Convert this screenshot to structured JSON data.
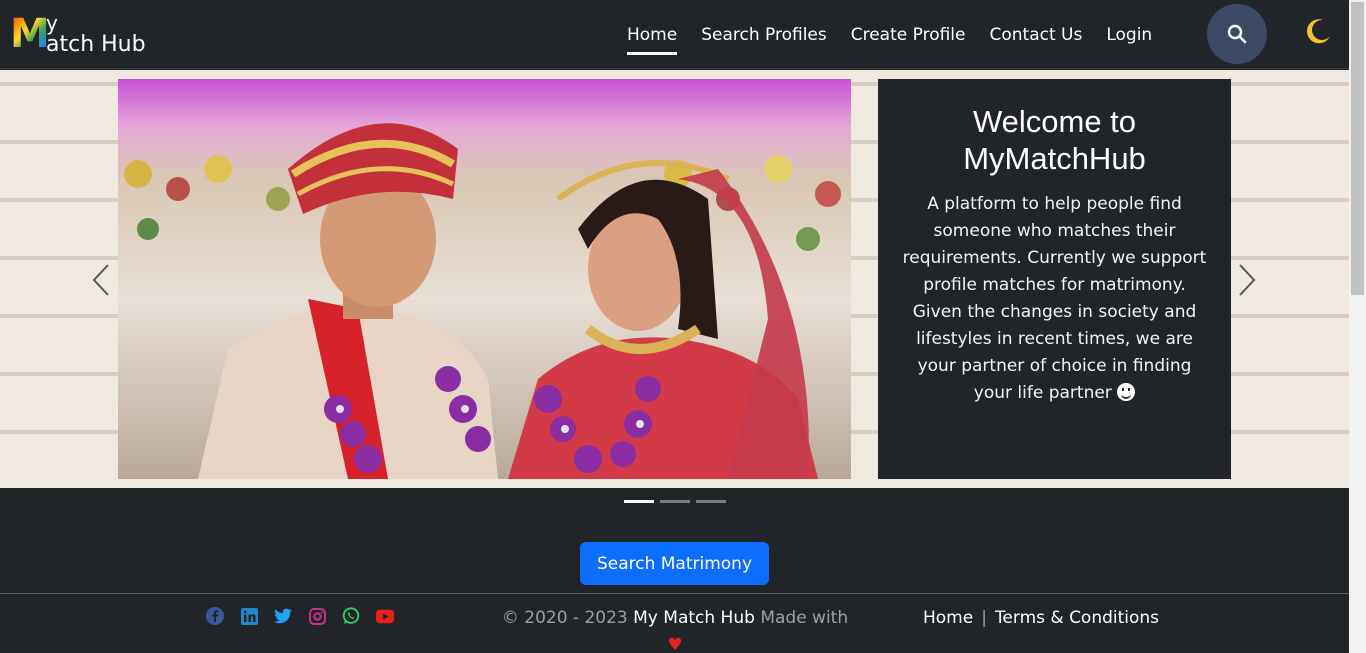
{
  "brand": {
    "m": "M",
    "y": "y",
    "rest": "atch Hub"
  },
  "nav": {
    "items": [
      {
        "label": "Home",
        "active": true
      },
      {
        "label": "Search Profiles",
        "active": false
      },
      {
        "label": "Create Profile",
        "active": false
      },
      {
        "label": "Contact Us",
        "active": false
      },
      {
        "label": "Login",
        "active": false
      }
    ],
    "search_icon": "search-icon",
    "theme_icon": "moon-icon"
  },
  "hero": {
    "title": "Welcome to MyMatchHub",
    "description": "A platform to help people find someone who matches their requirements. Currently we support profile matches for matrimony. Given the changes in society and lifestyles in recent times, we are your partner of choice in finding your life partner",
    "slide_count": 3,
    "active_slide": 1
  },
  "cta": {
    "label": "Search Matrimony"
  },
  "footer": {
    "socials": [
      "facebook-icon",
      "linkedin-icon",
      "twitter-icon",
      "instagram-icon",
      "whatsapp-icon",
      "youtube-icon"
    ],
    "copyright_prefix": "© 2020 - 2023",
    "brand_name": "My Match Hub",
    "made_with": "Made with",
    "heart": "♥",
    "links": [
      "Home",
      "Terms & Conditions"
    ],
    "separator": "|"
  },
  "colors": {
    "background": "#212529",
    "primary": "#0d6efd",
    "search_button": "#3d4a66",
    "moon": "#f4c430",
    "heart": "#e02424"
  }
}
